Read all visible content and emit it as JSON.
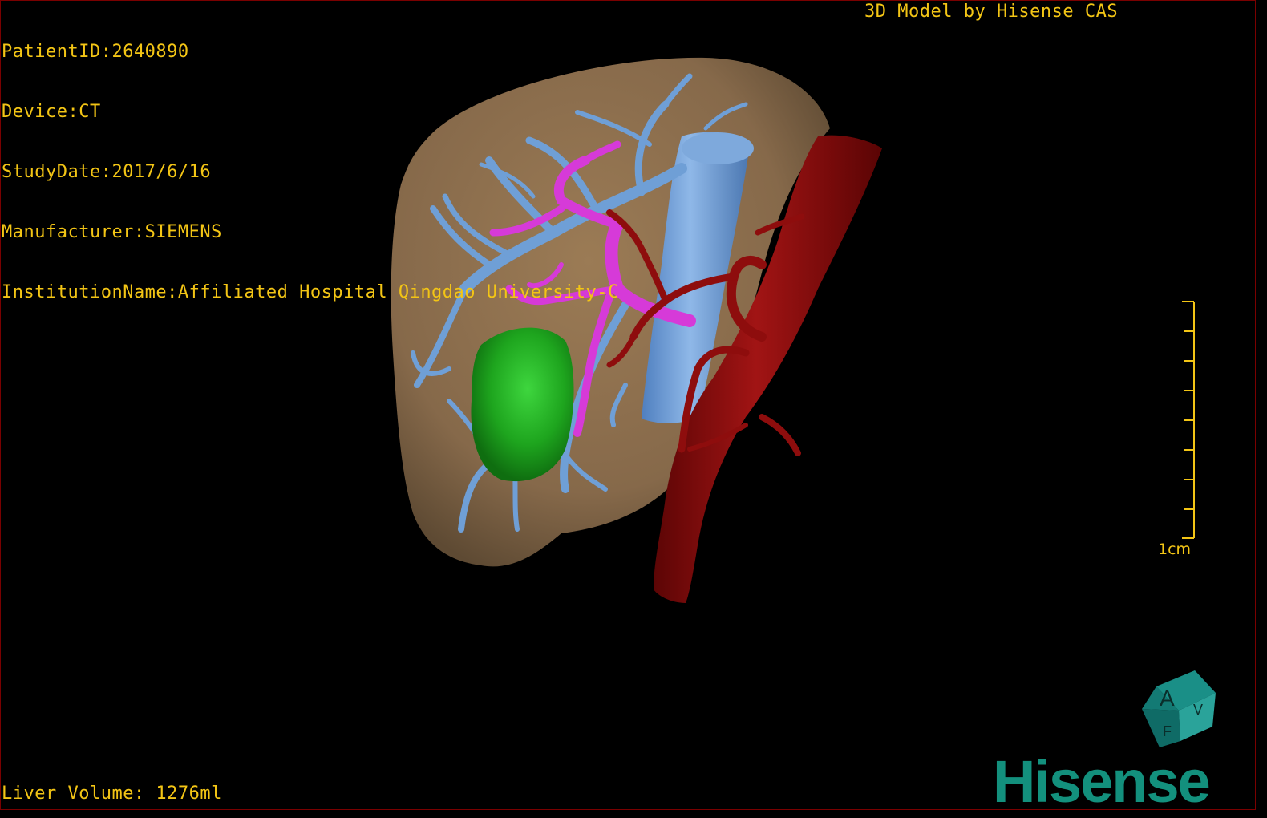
{
  "dicom_info": {
    "patient_id": "PatientID:2640890",
    "device": "Device:CT",
    "study_date": "StudyDate:2017/6/16",
    "manufacturer": "Manufacturer:SIEMENS",
    "institution": "InstitutionName:Affiliated Hospital Qingdao University-C"
  },
  "model_credit": "3D Model by Hisense CAS",
  "liver_volume": "Liver Volume: 1276ml",
  "scale_bar": {
    "label": "1cm"
  },
  "orientation_cube": {
    "face_front": "A",
    "face_side": "V",
    "face_bottom": "F"
  },
  "brand_logo": "Hisense",
  "colors": {
    "overlay_text": "#f3c515",
    "liver": "#8a6e4a",
    "hepatic_vein": "#6f9fd6",
    "portal_vein": "#d63ad8",
    "artery_aorta": "#8e0d0d",
    "tumor": "#1ea51e",
    "logo": "#13907d"
  }
}
